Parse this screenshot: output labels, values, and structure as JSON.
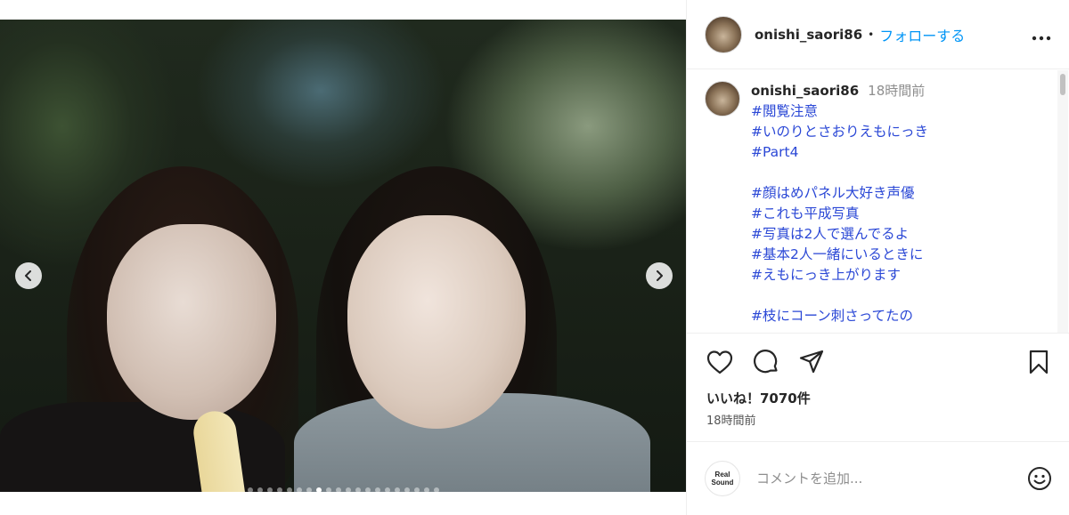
{
  "post": {
    "username": "onishi_saori86",
    "follow_label": "フォローする",
    "separator": "•",
    "more_icon": "more-horizontal-icon",
    "caption": {
      "time": "18時間前",
      "lines": [
        "#閲覧注意",
        "#いのりとさおりえもにっき",
        "#Part4",
        "",
        "#顔はめパネル大好き声優",
        "#これも平成写真",
        "#写真は2人で選んでるよ",
        "#基本2人一緒にいるときに",
        "#えもにっき上がります",
        "",
        "#枝にコーン刺さってたの"
      ]
    },
    "likes": "いいね！7070件",
    "posted": "18時間前",
    "carousel": {
      "total": 20,
      "active": 7
    }
  },
  "comment": {
    "placeholder": "コメントを追加...",
    "logo_line1": "Real",
    "logo_line2": "Sound"
  },
  "colors": {
    "link": "#2b48d6",
    "follow": "#0095f6",
    "meta": "#8e8e8e"
  }
}
